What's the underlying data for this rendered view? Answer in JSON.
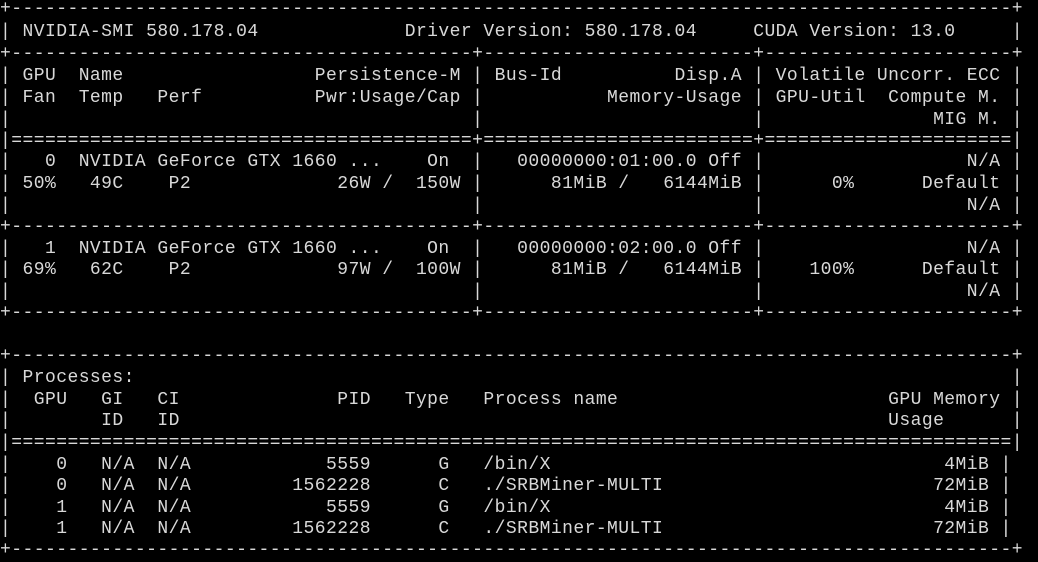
{
  "theme": {
    "background": "#000000",
    "foreground": "#d8d8d8"
  },
  "lines": [
    "+-----------------------------------------------------------------------------------------+",
    "| NVIDIA-SMI 580.178.04             Driver Version: 580.178.04     CUDA Version: 13.0     |",
    "+-----------------------------------------+------------------------+----------------------+",
    "| GPU  Name                 Persistence-M | Bus-Id          Disp.A | Volatile Uncorr. ECC |",
    "| Fan  Temp   Perf          Pwr:Usage/Cap |           Memory-Usage | GPU-Util  Compute M. |",
    "|                                         |                        |               MIG M. |",
    "|=========================================+========================+======================|",
    "|   0  NVIDIA GeForce GTX 1660 ...    On  |   00000000:01:00.0 Off |                  N/A |",
    "| 50%   49C    P2             26W /  150W |      81MiB /   6144MiB |      0%      Default |",
    "|                                         |                        |                  N/A |",
    "+-----------------------------------------+------------------------+----------------------+",
    "|   1  NVIDIA GeForce GTX 1660 ...    On  |   00000000:02:00.0 Off |                  N/A |",
    "| 69%   62C    P2             97W /  100W |      81MiB /   6144MiB |    100%      Default |",
    "|                                         |                        |                  N/A |",
    "+-----------------------------------------+------------------------+----------------------+",
    "",
    "+-----------------------------------------------------------------------------------------+",
    "| Processes:                                                                              |",
    "|  GPU   GI   CI              PID   Type   Process name                        GPU Memory |",
    "|        ID   ID                                                               Usage      |",
    "|=========================================================================================|",
    "|    0   N/A  N/A            5559      G   /bin/X                                   4MiB |",
    "|    0   N/A  N/A         1562228      C   ./SRBMiner-MULTI                        72MiB |",
    "|    1   N/A  N/A            5559      G   /bin/X                                   4MiB |",
    "|    1   N/A  N/A         1562228      C   ./SRBMiner-MULTI                        72MiB |",
    "+-----------------------------------------------------------------------------------------+"
  ]
}
